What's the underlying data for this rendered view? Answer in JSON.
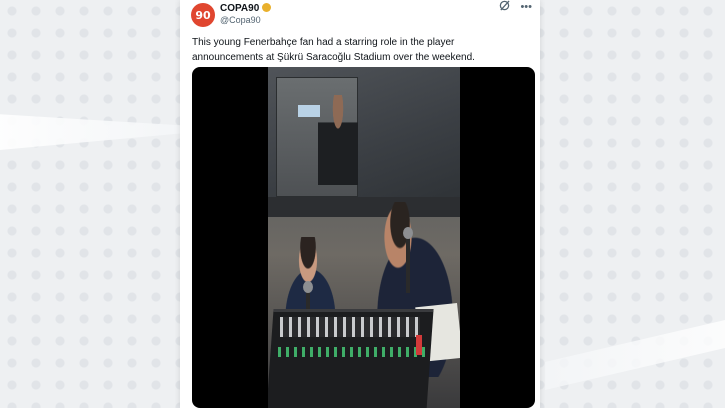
{
  "post": {
    "author_name": "COPA90",
    "author_handle": "@Copa90",
    "avatar_text": "90",
    "avatar_color": "#e0462f",
    "badge_color": "#e9b02c",
    "text": "This young Fenerbahçe fan had a starring role in the player announcements at Şükrü Saracoğlu Stadium over the weekend."
  },
  "icons": {
    "grok": "grok-icon",
    "more": "more-icon"
  }
}
